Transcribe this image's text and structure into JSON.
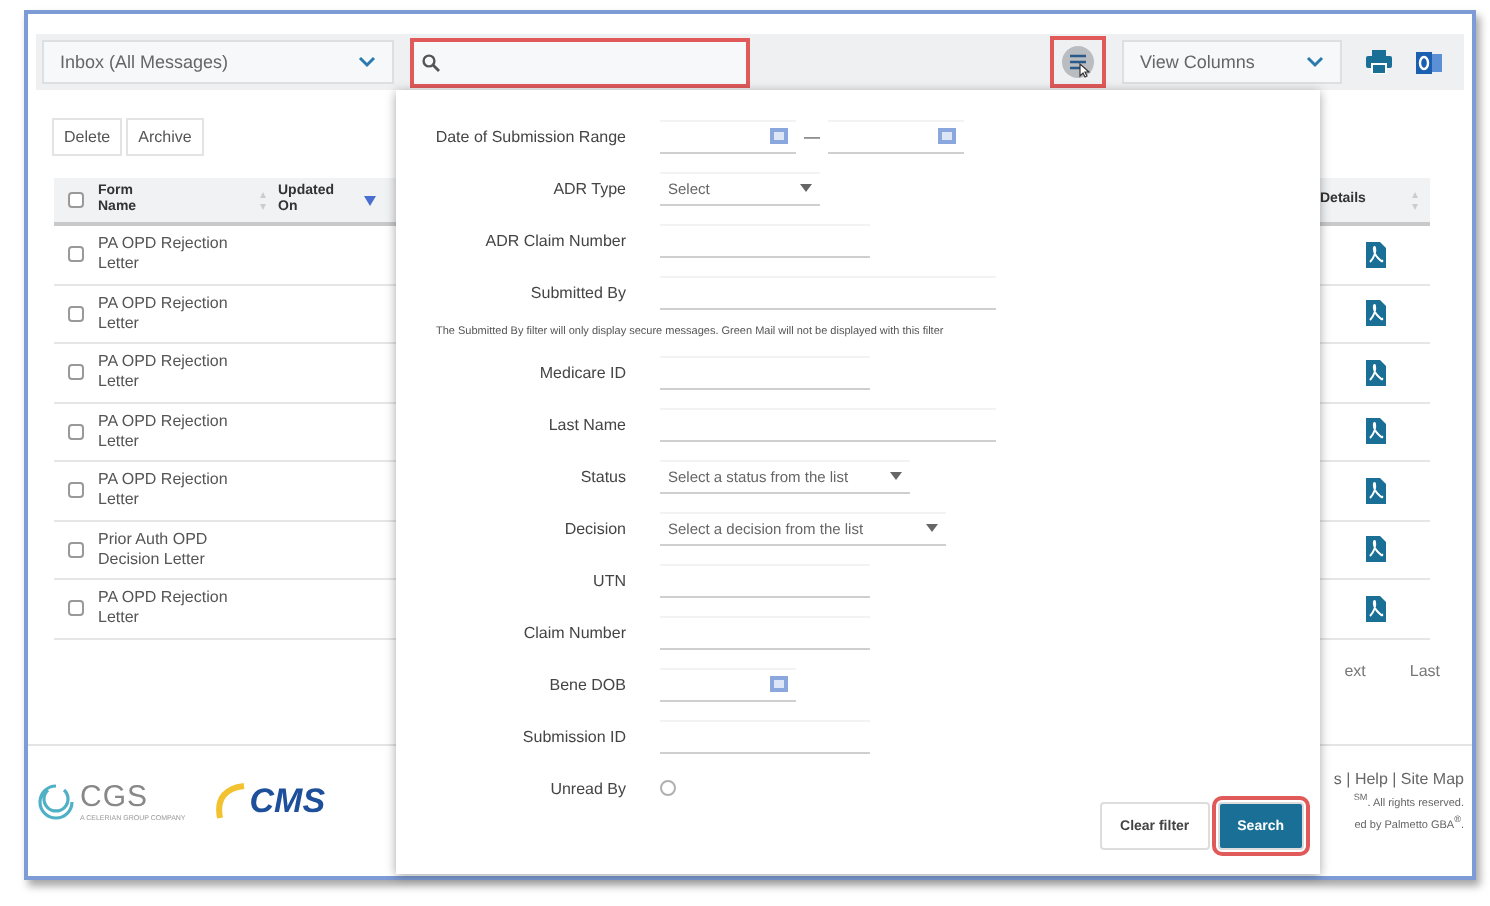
{
  "toolbar": {
    "folder_select": "Inbox (All Messages)",
    "search": {
      "highlighted": true
    },
    "filter_button": {
      "highlighted": true
    },
    "view_columns": "View Columns"
  },
  "actions": [
    "Delete",
    "Archive"
  ],
  "table": {
    "select_all_checked": false,
    "columns": [
      {
        "label": "Form Name",
        "sorted": false
      },
      {
        "label": "Updated On",
        "sorted": true
      },
      {
        "label": "Details",
        "sorted": false
      }
    ],
    "rows": [
      {
        "form_name": "PA OPD Rejection Letter",
        "checked": false
      },
      {
        "form_name": "PA OPD Rejection Letter",
        "checked": false
      },
      {
        "form_name": "PA OPD Rejection Letter",
        "checked": false
      },
      {
        "form_name": "PA OPD Rejection Letter",
        "checked": false
      },
      {
        "form_name": "PA OPD Rejection Letter",
        "checked": false
      },
      {
        "form_name": "Prior Auth OPD Decision Letter",
        "checked": false
      },
      {
        "form_name": "PA OPD Rejection Letter",
        "checked": false
      }
    ]
  },
  "pagination": [
    "ext",
    "Last"
  ],
  "footer": {
    "cgs_logo": "CGS",
    "cgs_tagline": "A CELERIAN GROUP COMPANY",
    "cms_logo": "CMS",
    "lines": [
      "s | Help | Site Map",
      "$^{SM}$. All rights reserved.",
      "ed by Palmetto GBA$^{®}$."
    ]
  },
  "filter_panel": {
    "fields": [
      {
        "kind": "date_range",
        "label": "Date of Submission Range",
        "separator": "—"
      },
      {
        "kind": "select",
        "label": "ADR Type",
        "placeholder": "Select"
      },
      {
        "kind": "text",
        "label": "ADR Claim Number"
      },
      {
        "kind": "text",
        "label": "Submitted By"
      },
      {
        "kind": "note",
        "text": "The Submitted By filter will only display secure messages.  Green Mail will not be displayed with this filter"
      },
      {
        "kind": "text",
        "label": "Medicare ID"
      },
      {
        "kind": "text",
        "label": "Last Name"
      },
      {
        "kind": "select",
        "label": "Status",
        "placeholder": "Select a status from the list"
      },
      {
        "kind": "select",
        "label": "Decision",
        "placeholder": "Select a decision from the list"
      },
      {
        "kind": "text",
        "label": "UTN"
      },
      {
        "kind": "text",
        "label": "Claim Number"
      },
      {
        "kind": "date",
        "label": "Bene DOB"
      },
      {
        "kind": "text",
        "label": "Submission ID"
      },
      {
        "kind": "radio",
        "label": "Unread By",
        "checked": false
      }
    ],
    "buttons": [
      {
        "label": "Clear filter",
        "primary": false,
        "highlighted": false
      },
      {
        "label": "Search",
        "primary": true,
        "highlighted": true
      }
    ]
  }
}
